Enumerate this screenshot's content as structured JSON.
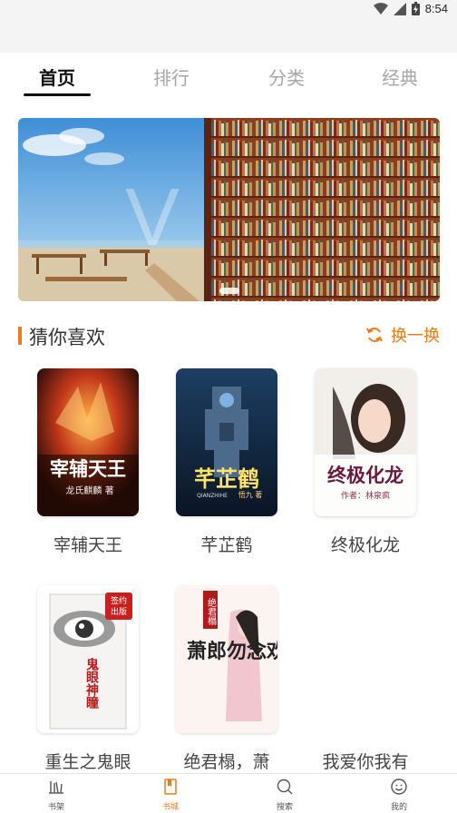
{
  "status_bar": {
    "time": "8:54"
  },
  "tabs": [
    {
      "label": "首页",
      "active": true
    },
    {
      "label": "排行",
      "active": false
    },
    {
      "label": "分类",
      "active": false
    },
    {
      "label": "经典",
      "active": false
    }
  ],
  "section": {
    "title": "猜你喜欢",
    "refresh_label": "换一换"
  },
  "books": [
    {
      "title": "宰辅天王",
      "cover_title": "宰辅天王",
      "cover_author": "龙氏麒麟  著"
    },
    {
      "title": "芊芷鹤",
      "cover_title": "芊芷鹤",
      "cover_subtitle": "QIANZHIHE",
      "cover_author": "悟九 著"
    },
    {
      "title": "终极化龙",
      "cover_title": "终极化龙",
      "cover_author": "作者：林泉疯"
    },
    {
      "title": "重生之鬼眼",
      "cover_title": "鬼眼神瞳",
      "cover_badge": "签约出版"
    },
    {
      "title": "绝君榻，萧",
      "cover_title": "萧郎勿念欢",
      "cover_top": "绝君榻"
    },
    {
      "title": "我爱你我有"
    }
  ],
  "bottom_nav": [
    {
      "label": "书架",
      "icon": "bookshelf-icon",
      "active": false
    },
    {
      "label": "书城",
      "icon": "book-icon",
      "active": true
    },
    {
      "label": "搜索",
      "icon": "search-icon",
      "active": false
    },
    {
      "label": "我的",
      "icon": "profile-icon",
      "active": false
    }
  ],
  "colors": {
    "accent": "#f07a1a",
    "active_tab": "#111111",
    "inactive_tab": "#a6a6a6"
  }
}
